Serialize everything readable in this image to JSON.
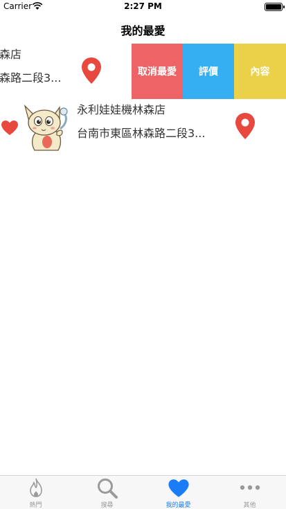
{
  "status_bar": {
    "carrier": "Carrier",
    "time": "2:27 PM"
  },
  "nav": {
    "title": "我的最愛"
  },
  "rows": [
    {
      "name": "永利娃娃機林森店",
      "address": "台南市東區林森路二段3..."
    },
    {
      "name": "永利娃娃機林森店",
      "address": "台南市東區林森路二段3..."
    }
  ],
  "row1_visible": {
    "name_fragment": "森店",
    "address_fragment": "森路二段3..."
  },
  "swipe_actions": {
    "unfavorite": "取消最愛",
    "review": "評價",
    "detail": "內容"
  },
  "tabs": [
    {
      "label": "熱門",
      "icon": "flame-icon",
      "active": false
    },
    {
      "label": "搜尋",
      "icon": "search-icon",
      "active": false
    },
    {
      "label": "我的最愛",
      "icon": "heart-icon",
      "active": true
    },
    {
      "label": "其他",
      "icon": "more-icon",
      "active": false
    }
  ],
  "colors": {
    "unfavorite": "#ee6466",
    "review": "#35aff2",
    "detail": "#ebd04a",
    "pin": "#e8493f",
    "heart": "#e8493f",
    "active_tab": "#1a7df7"
  }
}
